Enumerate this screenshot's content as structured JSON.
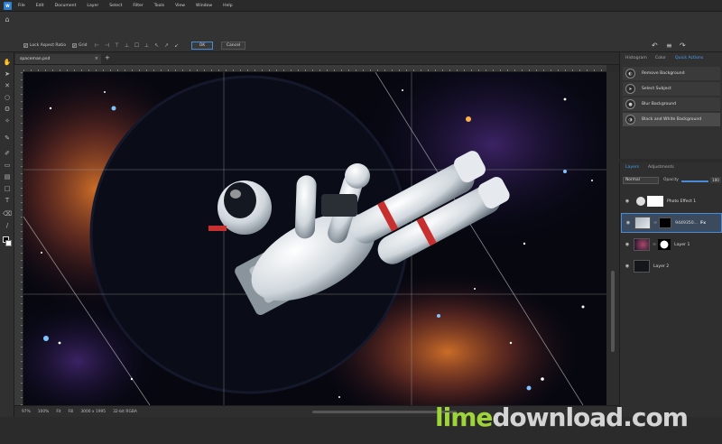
{
  "app": {
    "logo": "W"
  },
  "menu": [
    "File",
    "Edit",
    "Document",
    "Layer",
    "Select",
    "Filter",
    "Tools",
    "View",
    "Window",
    "Help"
  ],
  "options": {
    "lock_aspect_label": "Lock Aspect Ratio",
    "grid_label": "Grid",
    "ok_label": "OK",
    "cancel_label": "Cancel"
  },
  "document": {
    "tab_title": "spaceman.psd",
    "close": "×",
    "new_tab": "+"
  },
  "status": {
    "zoom": "97%",
    "zoom2": "100%",
    "fit": "Fit",
    "fill": "Fill",
    "dimensions": "3000 x 1995",
    "mode": "32-bit RGBA"
  },
  "panel_tabs": [
    "Histogram",
    "Color",
    "Quick Actions"
  ],
  "quick_actions": [
    "Remove Background",
    "Select Subject",
    "Blur Background",
    "Black and White Background"
  ],
  "layers_tabs": [
    "Layers",
    "Adjustments"
  ],
  "layers_controls": {
    "blend_mode": "Normal",
    "opacity_label": "Opacity",
    "opacity_value": "100"
  },
  "layers": [
    {
      "name": "Photo Effect 1"
    },
    {
      "name": "9449350...",
      "fx": "Fx"
    },
    {
      "name": "Layer 1"
    },
    {
      "name": "Layer 2"
    }
  ],
  "watermark": {
    "part_a": "lime",
    "part_b": "download.com"
  },
  "colors": {
    "accent": "#4a8bd8",
    "quick_action_tab": "#4aa0f0"
  }
}
